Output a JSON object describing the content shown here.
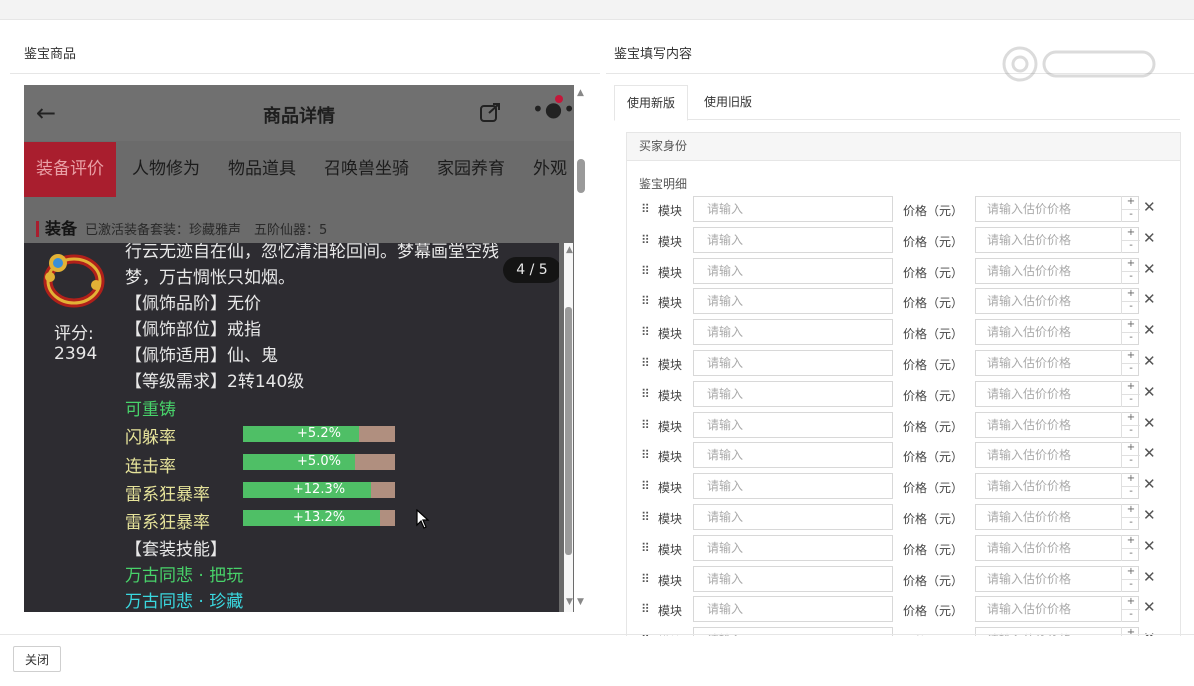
{
  "left_panel": {
    "title": "鉴宝商品"
  },
  "right_panel": {
    "title": "鉴宝填写内容"
  },
  "phone": {
    "header_title": "商品详情",
    "tabs": [
      "装备评价",
      "人物修为",
      "物品道具",
      "召唤兽坐骑",
      "家园养育",
      "外观"
    ],
    "equip_label": "装备",
    "equip_info": "已激活装备套装：珍藏雅声　五阶仙器：5",
    "popup": {
      "lines": [
        "行云无迹自在仙，忽忆清泪轮回间。梦幕画堂空残",
        "梦，万古惆怅只如烟。"
      ],
      "page": "4 / 5",
      "score_label": "评分:",
      "score_value": "2394",
      "attrs": [
        "【佩饰品阶】无价",
        "【佩饰部位】戒指",
        "【佩饰适用】仙、鬼",
        "【等级需求】2转140级"
      ],
      "recast": "可重铸",
      "stats": [
        {
          "name": "闪躲率",
          "value": "+5.2%",
          "fill": 0.76
        },
        {
          "name": "连击率",
          "value": "+5.0%",
          "fill": 0.74
        },
        {
          "name": "雷系狂暴率",
          "value": "+12.3%",
          "fill": 0.84
        },
        {
          "name": "雷系狂暴率",
          "value": "+13.2%",
          "fill": 0.9
        }
      ],
      "set_title": "【套装技能】",
      "skills": [
        "万古同悲 · 把玩",
        "万古同悲 · 珍藏"
      ]
    }
  },
  "form": {
    "tabs": [
      "使用新版",
      "使用旧版"
    ],
    "section_head": "买家身份",
    "detail_label": "鉴宝明细",
    "row_label": "模块",
    "input_placeholder": "请输入",
    "price_label": "价格（元）",
    "price_placeholder": "请输入估价价格",
    "step_up": "+",
    "step_down": "-",
    "delete_glyph": "✕",
    "drag_glyph": "⠿",
    "row_count": 15
  },
  "footer": {
    "close_label": "关闭"
  },
  "icons": [
    "back-arrow-icon",
    "share-icon",
    "more-icon",
    "ring-icon",
    "drag-handle-icon",
    "close-icon",
    "mouse-cursor-icon"
  ],
  "colors": {
    "accent_red": "#a91e2e",
    "green_text": "#48d36a",
    "cyan_text": "#3ad8e0",
    "stat_fill": "#4fbf66"
  }
}
